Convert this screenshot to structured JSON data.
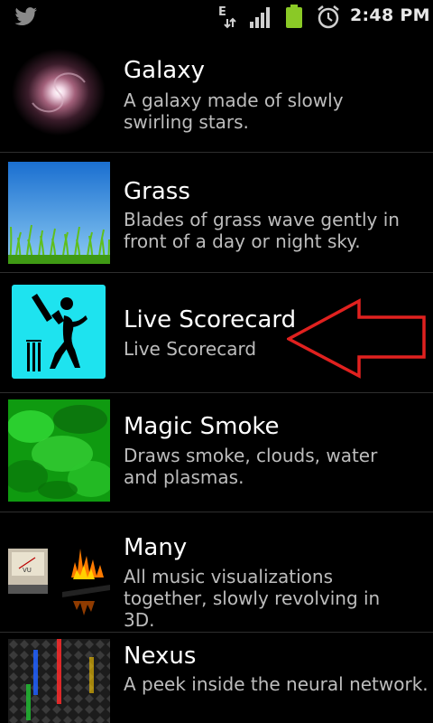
{
  "status_bar": {
    "time": "2:48 PM",
    "network_type": "E",
    "icons": [
      "twitter-bird-icon",
      "network-e-icon",
      "signal-icon",
      "battery-icon",
      "alarm-icon"
    ],
    "battery_color": "#8ac926"
  },
  "items": [
    {
      "title": "Galaxy",
      "description": "A galaxy made of slowly swirling stars."
    },
    {
      "title": "Grass",
      "description": "Blades of grass wave gently in front of a day or night sky."
    },
    {
      "title": "Live Scorecard",
      "description": "Live Scorecard"
    },
    {
      "title": "Magic Smoke",
      "description": "Draws smoke, clouds, water and plasmas."
    },
    {
      "title": "Many",
      "description": "All music visualizations together, slowly revolving in 3D."
    },
    {
      "title": "Nexus",
      "description": "A peek inside the neural network."
    }
  ],
  "annotation": {
    "arrow_color": "#e0211f",
    "points_to": "Live Scorecard"
  },
  "colors": {
    "background": "#000000",
    "title": "#ffffff",
    "description": "#bdbdbd",
    "scorecard_icon_bg": "#1ee3ef"
  }
}
